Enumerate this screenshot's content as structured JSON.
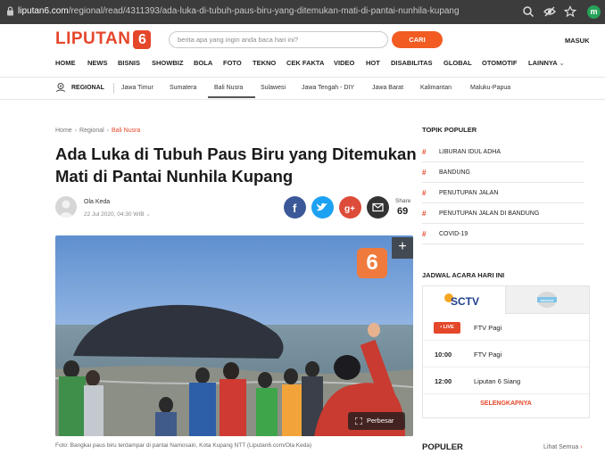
{
  "browser": {
    "url_domain": "liputan6.com",
    "url_path": "/regional/read/4311393/ada-luka-di-tubuh-paus-biru-yang-ditemukan-mati-di-pantai-nunhila-kupang",
    "profile_initial": "m",
    "icons": [
      "lock-icon",
      "search-icon",
      "eye-off-icon",
      "star-icon",
      "avatar"
    ]
  },
  "header": {
    "logo_text": "LIPUTAN",
    "logo_number": "6",
    "search_placeholder": "berita apa yang ingin anda baca hari ini?",
    "search_button": "CARI",
    "login": "MASUK"
  },
  "main_nav": [
    "HOME",
    "NEWS",
    "BISNIS",
    "SHOWBIZ",
    "BOLA",
    "FOTO",
    "TEKNO",
    "CEK FAKTA",
    "VIDEO",
    "HOT",
    "DISABILITAS",
    "GLOBAL",
    "OTOMOTIF",
    "LAINNYA"
  ],
  "sub_nav": {
    "section": "REGIONAL",
    "items": [
      "Jawa Timur",
      "Sumatera",
      "Bali Nusra",
      "Sulawesi",
      "Jawa Tengah - DIY",
      "Jawa Barat",
      "Kalimantan",
      "Maluku-Papua"
    ],
    "active": "Bali Nusra"
  },
  "breadcrumb": [
    "Home",
    "Regional",
    "Bali Nusra"
  ],
  "article": {
    "title": "Ada Luka di Tubuh Paus Biru yang Ditemukan Mati di Pantai Nunhila Kupang",
    "author": "Ola Keda",
    "date": "22 Jul 2020, 04:30 WIB",
    "share_label": "Share",
    "share_count": "69",
    "share_buttons": [
      "facebook-icon",
      "twitter-icon",
      "google-plus-icon",
      "email-icon"
    ],
    "photo_badge": "6",
    "photo_plus": "+",
    "enlarge_label": "Perbesar",
    "caption": "Foto: Bangkai paus biru terdampar di pantai Namosain, Kota Kupang NTT (Liputan6.com/Ola Keda)"
  },
  "sidebar": {
    "topik_title": "TOPIK POPULER",
    "topik_items": [
      "LIBURAN IDUL ADHA",
      "BANDUNG",
      "PENUTUPAN JALAN",
      "PENUTUPAN JALAN DI BANDUNG",
      "COVID-19"
    ],
    "jadwal_title": "JADWAL ACARA HARI INI",
    "channel_a": "SCTV",
    "channel_b": "INDOSIAR",
    "live_label": "LIVE",
    "schedule": [
      {
        "time": "",
        "program": "FTV Pagi"
      },
      {
        "time": "10:00",
        "program": "FTV Pagi"
      },
      {
        "time": "12:00",
        "program": "Liputan 6 Siang"
      }
    ],
    "more": "SELENGKAPNYA",
    "populer_title": "POPULER",
    "lihat_semua": "Lihat Semua"
  },
  "colors": {
    "brand": "#e5472a",
    "search_button": "#f25c22",
    "facebook": "#3b5998",
    "twitter": "#1da1f2",
    "google_plus": "#dd4b39",
    "email": "#333333"
  }
}
